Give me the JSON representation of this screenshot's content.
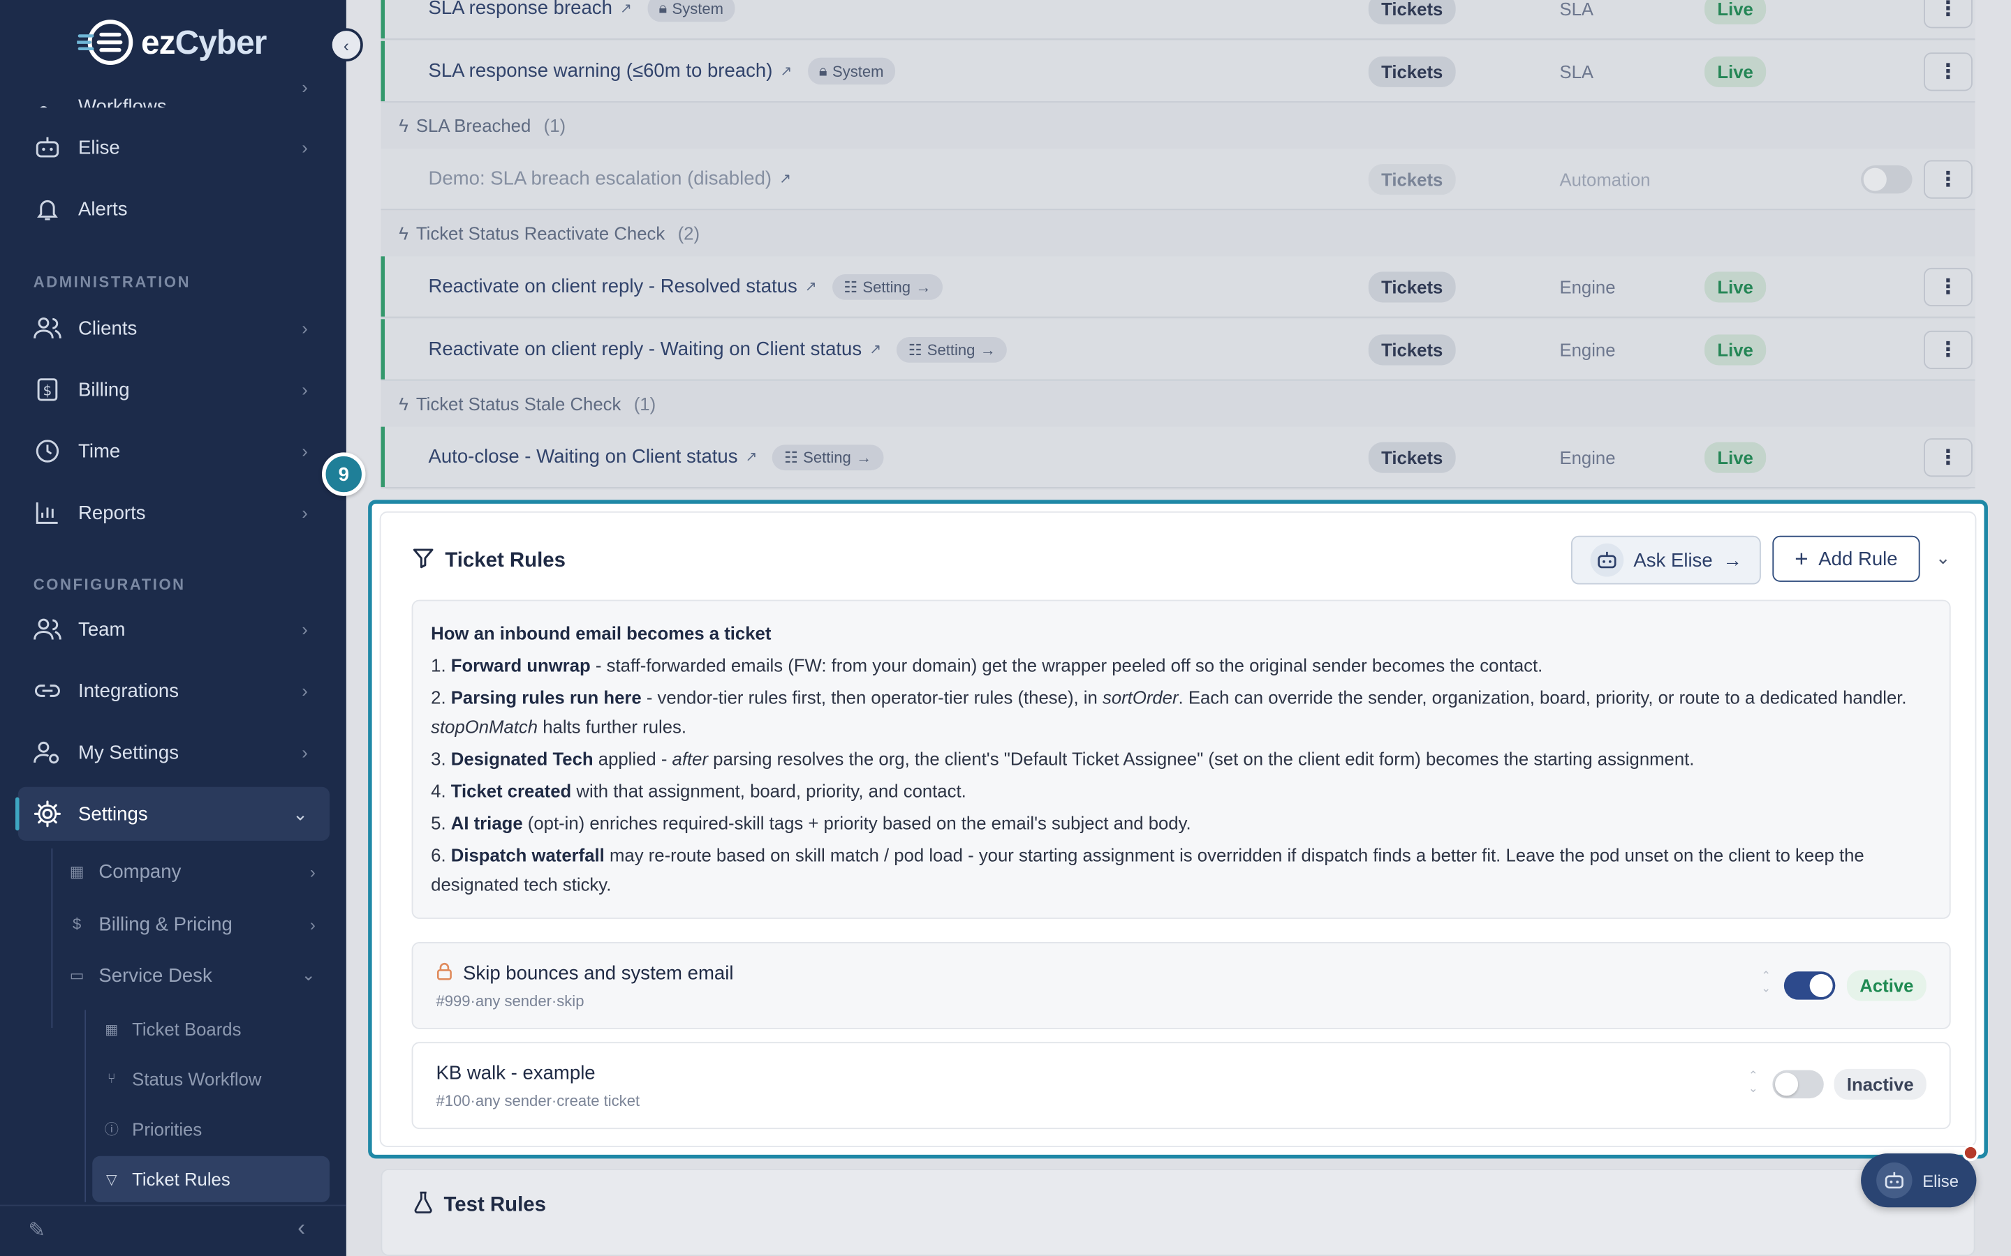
{
  "brand": {
    "logo_prefix": "ez",
    "logo_suffix": "Cyber"
  },
  "sidebar": {
    "partial_item": "Workflows",
    "items_top": [
      {
        "label": "Elise",
        "icon": "bot-icon",
        "chevron": true
      },
      {
        "label": "Alerts",
        "icon": "bell-icon",
        "chevron": false
      }
    ],
    "section_admin": "ADMINISTRATION",
    "admin_items": [
      {
        "label": "Clients",
        "icon": "users-icon"
      },
      {
        "label": "Billing",
        "icon": "dollar-icon"
      },
      {
        "label": "Time",
        "icon": "clock-icon"
      },
      {
        "label": "Reports",
        "icon": "chart-icon"
      }
    ],
    "section_config": "CONFIGURATION",
    "config_items": [
      {
        "label": "Team",
        "icon": "users-icon"
      },
      {
        "label": "Integrations",
        "icon": "link-icon"
      },
      {
        "label": "My Settings",
        "icon": "user-gear-icon"
      },
      {
        "label": "Settings",
        "icon": "gear-icon"
      }
    ],
    "settings_sub": [
      {
        "label": "Company",
        "icon": "building-icon"
      },
      {
        "label": "Billing & Pricing",
        "icon": "dollar-icon"
      },
      {
        "label": "Service Desk",
        "icon": "ticket-icon"
      }
    ],
    "service_desk_sub": [
      {
        "label": "Ticket Boards",
        "icon": "grid-icon"
      },
      {
        "label": "Status Workflow",
        "icon": "workflow-icon"
      },
      {
        "label": "Priorities",
        "icon": "info-icon"
      },
      {
        "label": "Ticket Rules",
        "icon": "filter-icon"
      }
    ]
  },
  "rules_list": {
    "rows": [
      {
        "title": "SLA response breach",
        "chip": "System",
        "chip_icon": "lock-icon",
        "category": "Tickets",
        "kind": "SLA",
        "status": "Live",
        "disabled": false
      },
      {
        "title": "SLA response warning (≤60m to breach)",
        "chip": "System",
        "chip_icon": "lock-icon",
        "category": "Tickets",
        "kind": "SLA",
        "status": "Live",
        "disabled": false
      },
      {
        "title": "Demo: SLA breach escalation (disabled)",
        "chip": "",
        "category": "Tickets",
        "kind": "Automation",
        "status": "",
        "disabled": true
      },
      {
        "title": "Reactivate on client reply - Resolved status",
        "chip": "Setting",
        "chip_icon": "sliders-icon",
        "category": "Tickets",
        "kind": "Engine",
        "status": "Live",
        "disabled": false
      },
      {
        "title": "Reactivate on client reply - Waiting on Client status",
        "chip": "Setting",
        "chip_icon": "sliders-icon",
        "category": "Tickets",
        "kind": "Engine",
        "status": "Live",
        "disabled": false
      },
      {
        "title": "Auto-close - Waiting on Client status",
        "chip": "Setting",
        "chip_icon": "sliders-icon",
        "category": "Tickets",
        "kind": "Engine",
        "status": "Live",
        "disabled": false
      }
    ],
    "groups": [
      {
        "label": "SLA Breached",
        "count": "(1)"
      },
      {
        "label": "Ticket Status Reactivate Check",
        "count": "(2)"
      },
      {
        "label": "Ticket Status Stale Check",
        "count": "(1)"
      }
    ]
  },
  "step_badge": "9",
  "ticket_rules": {
    "title": "Ticket Rules",
    "ask_label": "Ask Elise",
    "add_label": "Add Rule",
    "info": {
      "heading": "How an inbound email becomes a ticket",
      "s1_num": "1.",
      "s1_bold": "Forward unwrap",
      "s1_text": " - staff-forwarded emails (FW: from your domain) get the wrapper peeled off so the original sender becomes the contact.",
      "s2_num": "2.",
      "s2_bold": "Parsing rules run here",
      "s2_text_a": " - vendor-tier rules first, then operator-tier rules (these), in ",
      "s2_italic_a": "sortOrder",
      "s2_text_b": ". Each can override the sender, organization, board, priority, or route to a dedicated handler. ",
      "s2_italic_b": "stopOnMatch",
      "s2_text_c": " halts further rules.",
      "s3_num": "3.",
      "s3_bold": "Designated Tech",
      "s3_text_a": " applied - ",
      "s3_italic": "after",
      "s3_text_b": " parsing resolves the org, the client's \"Default Ticket Assignee\" (set on the client edit form) becomes the starting assignment.",
      "s4_num": "4.",
      "s4_bold": "Ticket created",
      "s4_text": " with that assignment, board, priority, and contact.",
      "s5_num": "5.",
      "s5_bold": "AI triage",
      "s5_text": " (opt-in) enriches required-skill tags + priority based on the email's subject and body.",
      "s6_num": "6.",
      "s6_bold": "Dispatch waterfall",
      "s6_text": " may re-route based on skill match / pod load - your starting assignment is overridden if dispatch finds a better fit. Leave the pod unset on the client to keep the designated tech sticky."
    },
    "rules": [
      {
        "name": "Skip bounces and system email",
        "meta": "#999·any sender·skip",
        "locked": true,
        "enabled": true,
        "status": "Active"
      },
      {
        "name": "KB walk - example",
        "meta": "#100·any sender·create ticket",
        "locked": false,
        "enabled": false,
        "status": "Inactive"
      }
    ]
  },
  "test_rules": {
    "title": "Test Rules"
  },
  "fab": {
    "label": "Elise"
  },
  "colors": {
    "sidebar_bg": "#1c2b4a",
    "accent": "#1f88a6",
    "live": "#1f8a52",
    "toggle_on": "#2d4a8c"
  }
}
